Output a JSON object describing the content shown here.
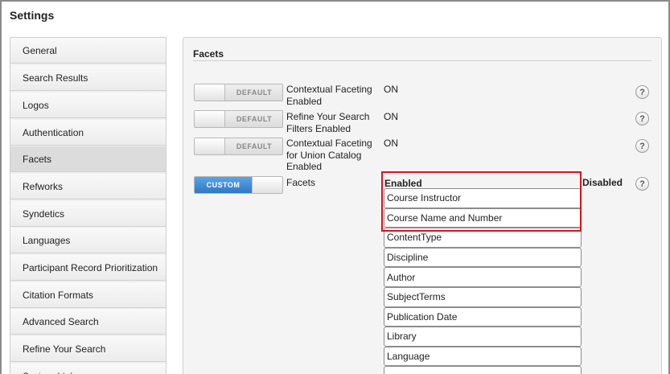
{
  "page": {
    "title": "Settings"
  },
  "sidebar": {
    "items": [
      {
        "label": "General"
      },
      {
        "label": "Search Results"
      },
      {
        "label": "Logos"
      },
      {
        "label": "Authentication"
      },
      {
        "label": "Facets"
      },
      {
        "label": "Refworks"
      },
      {
        "label": "Syndetics"
      },
      {
        "label": "Languages"
      },
      {
        "label": "Participant Record Prioritization"
      },
      {
        "label": "Citation Formats"
      },
      {
        "label": "Advanced Search"
      },
      {
        "label": "Refine Your Search"
      },
      {
        "label": "System Links"
      }
    ],
    "active": "Facets"
  },
  "panel": {
    "title": "Facets",
    "rows": [
      {
        "toggle": "DEFAULT",
        "label": "Contextual Faceting Enabled",
        "value": "ON"
      },
      {
        "toggle": "DEFAULT",
        "label": "Refine Your Search Filters Enabled",
        "value": "ON"
      },
      {
        "toggle": "DEFAULT",
        "label": "Contextual Faceting for Union Catalog Enabled",
        "value": "ON"
      },
      {
        "toggle": "CUSTOM",
        "label": "Facets"
      }
    ],
    "help_symbol": "?",
    "enabled_header": "Enabled",
    "disabled_header": "Disabled",
    "enabled_facets": [
      "Course Instructor",
      "Course Name and Number",
      "ContentType",
      "Discipline",
      "Author",
      "SubjectTerms",
      "Publication Date",
      "Library",
      "Language"
    ],
    "highlight_color": "#e0101a",
    "accent_color": "#2e78c6"
  }
}
